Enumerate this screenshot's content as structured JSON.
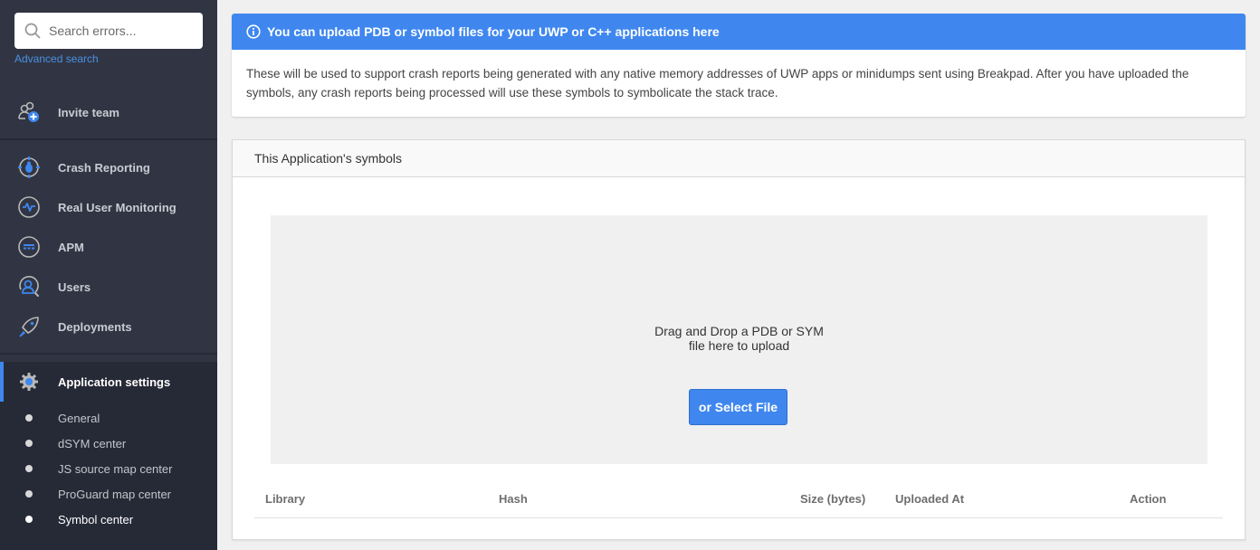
{
  "sidebar": {
    "search": {
      "placeholder": "Search errors...",
      "value": ""
    },
    "advanced_search": "Advanced search",
    "invite_team": "Invite team",
    "nav": [
      {
        "label": "Crash Reporting",
        "icon": "crash-reporting-icon"
      },
      {
        "label": "Real User Monitoring",
        "icon": "rum-pulse-icon"
      },
      {
        "label": "APM",
        "icon": "apm-icon"
      },
      {
        "label": "Users",
        "icon": "users-icon"
      },
      {
        "label": "Deployments",
        "icon": "rocket-icon"
      }
    ],
    "settings": {
      "label": "Application settings",
      "items": [
        {
          "label": "General"
        },
        {
          "label": "dSYM center"
        },
        {
          "label": "JS source map center"
        },
        {
          "label": "ProGuard map center"
        },
        {
          "label": "Symbol center",
          "active": true
        }
      ]
    }
  },
  "info": {
    "title": "You can upload PDB or symbol files for your UWP or C++ applications here",
    "body": "These will be used to support crash reports being generated with any native memory addresses of UWP apps or minidumps sent using Breakpad. After you have uploaded the symbols, any crash reports being processed will use these symbols to symbolicate the stack trace."
  },
  "symbols": {
    "title": "This Application's symbols",
    "drop_line1": "Drag and Drop a PDB or SYM",
    "drop_line2": "file here to upload",
    "select_button": "or Select File",
    "columns": [
      "Library",
      "Hash",
      "Size (bytes)",
      "Uploaded At",
      "Action"
    ],
    "rows": []
  },
  "colors": {
    "accent": "#3f87ef",
    "sidebar_bg": "#313543",
    "sidebar_active_bg": "#262a36"
  }
}
